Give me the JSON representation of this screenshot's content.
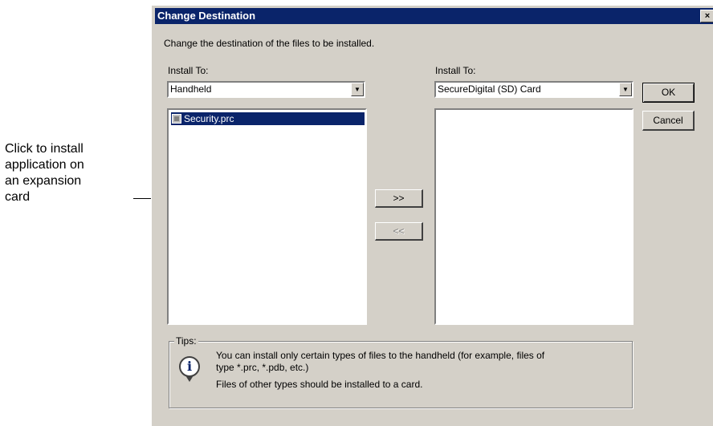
{
  "callout": {
    "lines": [
      "Click to install",
      "application on",
      "an expansion",
      "card"
    ]
  },
  "dialog": {
    "title": "Change Destination",
    "close_glyph": "×",
    "instruction": "Change the destination of the files to be installed.",
    "left": {
      "label": "Install To:",
      "combo_value": "Handheld",
      "files": [
        "Security.prc"
      ],
      "file_icon": "prc-file-icon"
    },
    "right": {
      "label": "Install To:",
      "combo_value": "SecureDigital (SD) Card",
      "files": []
    },
    "buttons": {
      "move_right": ">>",
      "move_left": "<<",
      "ok": "OK",
      "cancel": "Cancel"
    },
    "tips": {
      "legend": "Tips:",
      "icon": "info-icon",
      "line1": "You can install only certain types of files to the handheld (for example, files of",
      "line2": "type *.prc, *.pdb, etc.)",
      "line3": "Files of other types should be installed to a card."
    }
  }
}
